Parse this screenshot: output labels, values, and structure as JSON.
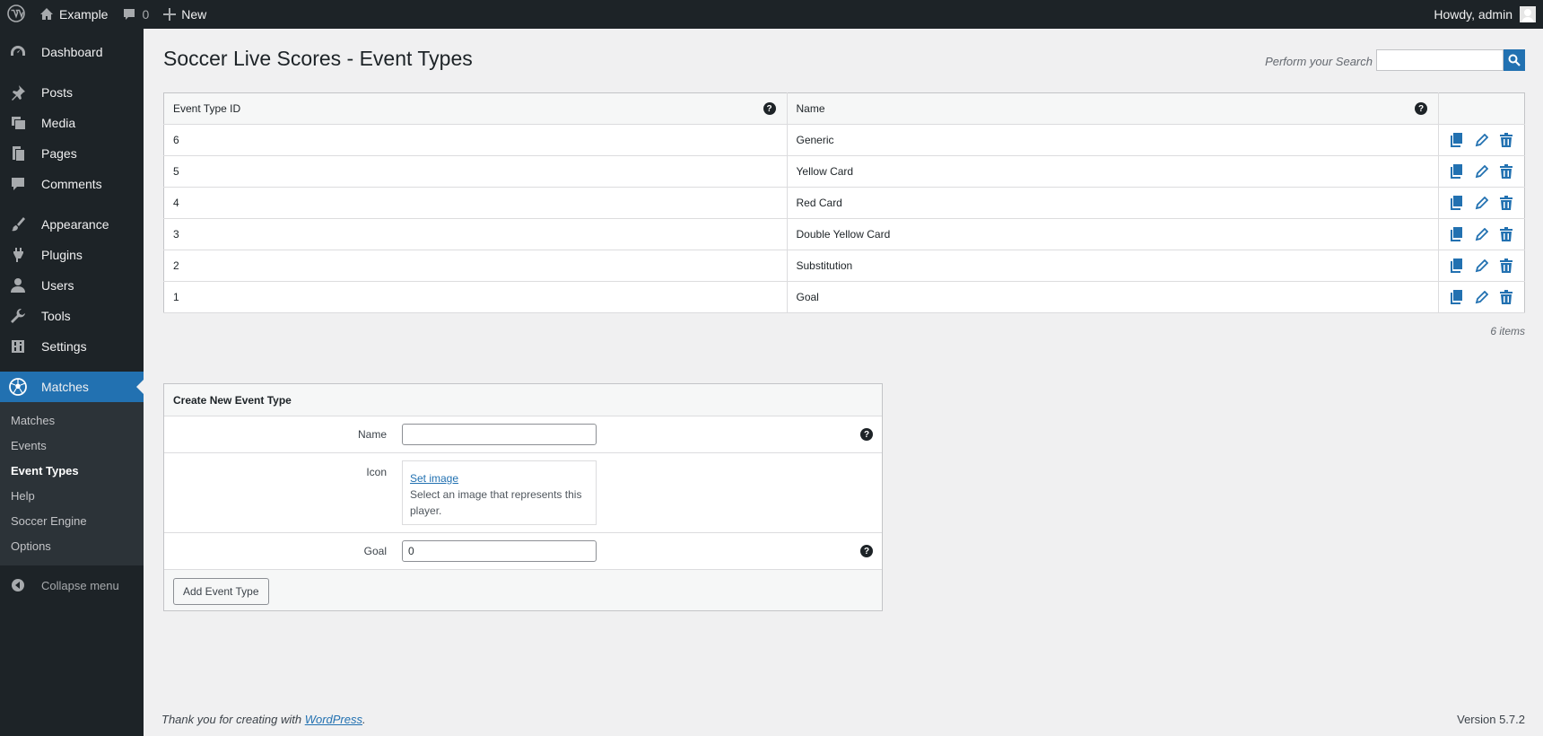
{
  "adminbar": {
    "wp_logo_icon": "wordpress-icon",
    "site_name": "Example",
    "comments_count": "0",
    "new_label": "New",
    "greeting": "Howdy, admin"
  },
  "sidebar": {
    "items": [
      {
        "label": "Dashboard",
        "icon": "dashboard-icon"
      },
      {
        "label": "Posts",
        "icon": "pin-icon"
      },
      {
        "label": "Media",
        "icon": "media-icon"
      },
      {
        "label": "Pages",
        "icon": "pages-icon"
      },
      {
        "label": "Comments",
        "icon": "comment-icon"
      },
      {
        "label": "Appearance",
        "icon": "brush-icon"
      },
      {
        "label": "Plugins",
        "icon": "plug-icon"
      },
      {
        "label": "Users",
        "icon": "user-icon"
      },
      {
        "label": "Tools",
        "icon": "wrench-icon"
      },
      {
        "label": "Settings",
        "icon": "settings-icon"
      },
      {
        "label": "Matches",
        "icon": "soccer-ball-icon"
      }
    ],
    "submenu": [
      "Matches",
      "Events",
      "Event Types",
      "Help",
      "Soccer Engine",
      "Options"
    ],
    "current_submenu": "Event Types",
    "collapse_label": "Collapse menu"
  },
  "page": {
    "title": "Soccer Live Scores - Event Types",
    "search_label": "Perform your Search",
    "search_value": ""
  },
  "table": {
    "headers": [
      "Event Type ID",
      "Name"
    ],
    "rows": [
      {
        "id": "6",
        "name": "Generic"
      },
      {
        "id": "5",
        "name": "Yellow Card"
      },
      {
        "id": "4",
        "name": "Red Card"
      },
      {
        "id": "3",
        "name": "Double Yellow Card"
      },
      {
        "id": "2",
        "name": "Substitution"
      },
      {
        "id": "1",
        "name": "Goal"
      }
    ],
    "items_count": "6 items"
  },
  "form": {
    "heading": "Create New Event Type",
    "name_label": "Name",
    "name_value": "",
    "icon_label": "Icon",
    "set_image_link": "Set image",
    "image_description": "Select an image that represents this player.",
    "goal_label": "Goal",
    "goal_value": "0",
    "submit_label": "Add Event Type"
  },
  "footer": {
    "thanks_prefix": "Thank you for creating with ",
    "wp_link": "WordPress",
    "thanks_suffix": ".",
    "version": "Version 5.7.2"
  },
  "colors": {
    "accent": "#2271b1",
    "adminbar": "#1d2327",
    "background": "#f0f0f1"
  }
}
